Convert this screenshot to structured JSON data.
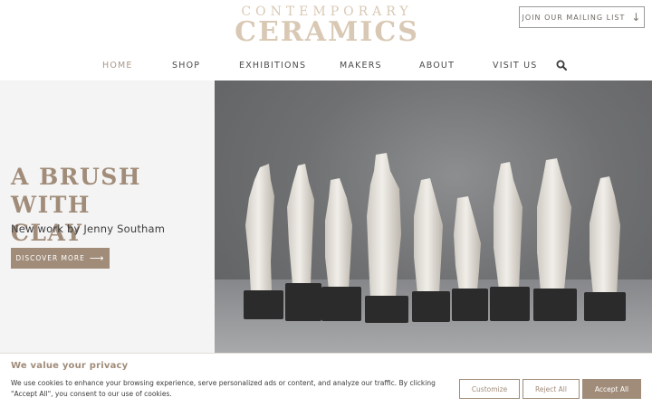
{
  "header": {
    "logo_top": "CONTEMPORARY",
    "logo_bottom": "CERAMICS",
    "mailing_label": "JOIN OUR MAILING LIST",
    "mailing_icon": "arrow-down-icon"
  },
  "nav": {
    "items": [
      {
        "label": "HOME",
        "active": true
      },
      {
        "label": "SHOP"
      },
      {
        "label": "EXHIBITIONS"
      },
      {
        "label": "MAKERS"
      },
      {
        "label": "ABOUT"
      },
      {
        "label": "VISIT US"
      }
    ],
    "search_icon": "search-icon"
  },
  "hero": {
    "title_line1": "A BRUSH WITH",
    "title_line2": "CLAY",
    "subtitle": "New work by Jenny Southam",
    "cta_label": "DISCOVER MORE",
    "cta_icon": "long-arrow-right-icon"
  },
  "cookie": {
    "title": "We value your privacy",
    "text": "We use cookies to enhance your browsing experience, serve personalized ads or content, and analyze our traffic. By clicking \"Accept All\", you consent to our use of cookies.",
    "customize": "Customize",
    "reject": "Reject All",
    "accept": "Accept All"
  },
  "colors": {
    "accent": "#a08c79",
    "logo": "#d9c9b4",
    "nav_active": "#a8998a",
    "hero_panel": "#f5f4f4"
  }
}
